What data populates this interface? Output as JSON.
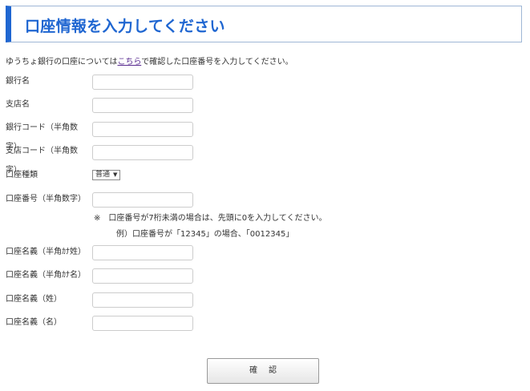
{
  "header": {
    "title": "口座情報を入力してください"
  },
  "intro": {
    "before_link": "ゆうちょ銀行の口座については",
    "link_text": "こちら",
    "after_link": "で確認した口座番号を入力してください。"
  },
  "fields": {
    "bank_name": {
      "label": "銀行名",
      "value": ""
    },
    "branch_name": {
      "label": "支店名",
      "value": ""
    },
    "bank_code": {
      "label": "銀行コード（半角数字）",
      "value": ""
    },
    "branch_code": {
      "label": "支店コード（半角数字）",
      "value": ""
    },
    "account_type": {
      "label": "口座種類",
      "selected": "普通"
    },
    "account_number": {
      "label": "口座番号（半角数字）",
      "value": ""
    },
    "holder_kana_last": {
      "label": "口座名義（半角ｶﾅ姓）",
      "value": ""
    },
    "holder_kana_first": {
      "label": "口座名義（半角ｶﾅ名）",
      "value": ""
    },
    "holder_last": {
      "label": "口座名義（姓）",
      "value": ""
    },
    "holder_first": {
      "label": "口座名義（名）",
      "value": ""
    }
  },
  "notes": {
    "line1": "※　口座番号が7桁未満の場合は、先頭に0を入力してください。",
    "line2": "例）口座番号が「12345」の場合、「0012345」"
  },
  "buttons": {
    "confirm_label": "確認"
  },
  "icons": {
    "select_arrow": "triangle-down-icon"
  },
  "colors": {
    "accent": "#1f66d1",
    "link": "#5a2d91"
  }
}
